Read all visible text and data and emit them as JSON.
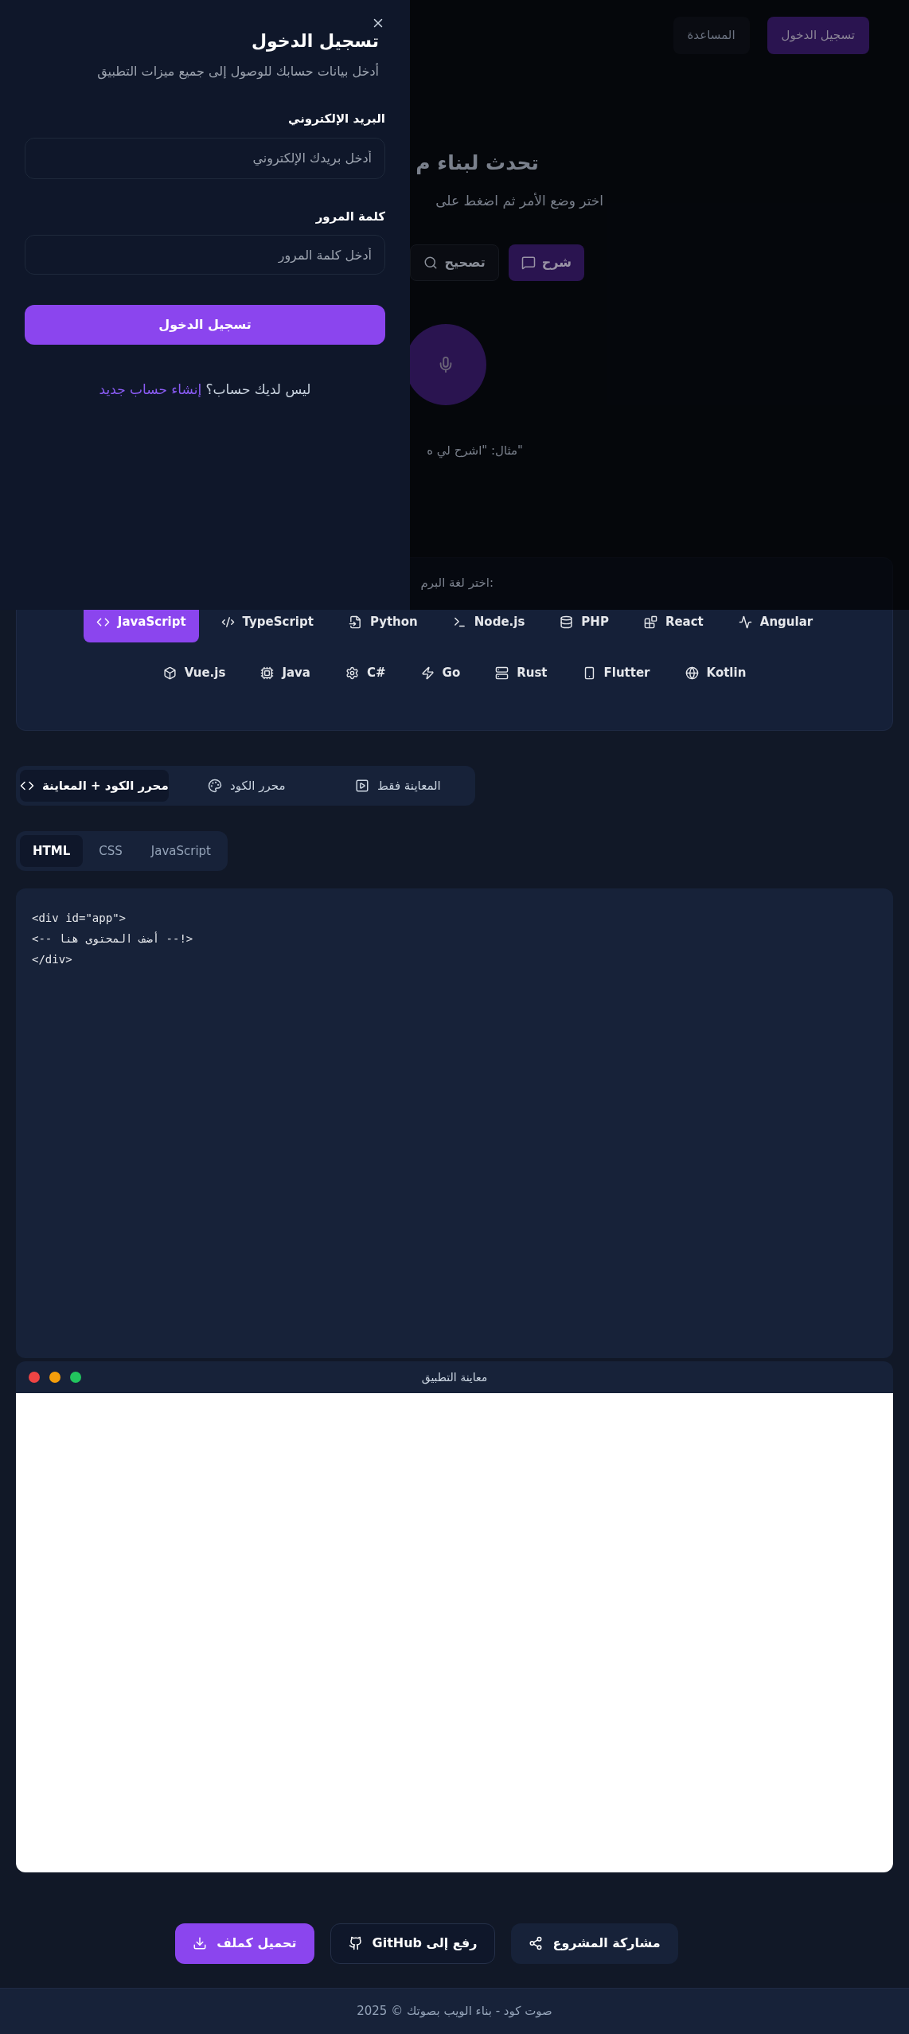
{
  "header": {
    "buttons": [
      {
        "label": "تسجيل الدخول",
        "kind": "primary"
      },
      {
        "label": "المساعدة",
        "kind": "ghost"
      }
    ]
  },
  "hero": {
    "title": "تحدث لبناء م",
    "subtitle": "اختر وضع الأمر ثم اضغط على",
    "modes": [
      {
        "label": "شرح",
        "selected": true
      },
      {
        "label": "تصحيح",
        "selected": false
      }
    ],
    "example": "\"مثال: \"اشرح لي ه"
  },
  "languages": {
    "label": "اختر لغة البرم:",
    "items": [
      {
        "label": "Angular",
        "selected": false
      },
      {
        "label": "React",
        "selected": false
      },
      {
        "label": "PHP",
        "selected": false
      },
      {
        "label": "Node.js",
        "selected": false
      },
      {
        "label": "Python",
        "selected": false
      },
      {
        "label": "TypeScript",
        "selected": false
      },
      {
        "label": "JavaScript",
        "selected": true
      },
      {
        "label": "Kotlin",
        "selected": false
      },
      {
        "label": "Flutter",
        "selected": false
      },
      {
        "label": "Rust",
        "selected": false
      },
      {
        "label": "Go",
        "selected": false
      },
      {
        "label": "C#",
        "selected": false
      },
      {
        "label": "Java",
        "selected": false
      },
      {
        "label": "Vue.js",
        "selected": false
      }
    ]
  },
  "view_tabs": [
    {
      "label": "المعاينة فقط",
      "selected": false
    },
    {
      "label": "محرر الكود",
      "selected": false
    },
    {
      "label": "محرر الكود + المعاينة",
      "selected": true
    }
  ],
  "file_tabs": [
    {
      "label": "JavaScript",
      "selected": false
    },
    {
      "label": "CSS",
      "selected": false
    },
    {
      "label": "HTML",
      "selected": true
    }
  ],
  "editor": {
    "lines": [
      "<div id=\"app\">",
      "  <!-- أضف المحتوى هنا -->",
      "</div>"
    ]
  },
  "preview": {
    "title": "معاينة التطبيق"
  },
  "actions": [
    {
      "label": "مشاركة المشروع",
      "kind": "secondary"
    },
    {
      "label": "رفع إلى GitHub",
      "kind": "outline"
    },
    {
      "label": "تحميل كملف",
      "kind": "primary"
    }
  ],
  "footer": {
    "text": "صوت كود - بناء الويب بصوتك © 2025"
  },
  "login": {
    "title": "تسجيل الدخول",
    "subtitle": "أدخل بيانات حسابك للوصول إلى جميع ميزات التطبيق",
    "email_label": "البريد الإلكتروني",
    "email_placeholder": "أدخل بريدك الإلكتروني",
    "password_label": "كلمة المرور",
    "password_placeholder": "أدخل كلمة المرور",
    "submit": "تسجيل الدخول",
    "prompt": "ليس لديك حساب؟",
    "link": "إنشاء حساب جديد"
  }
}
